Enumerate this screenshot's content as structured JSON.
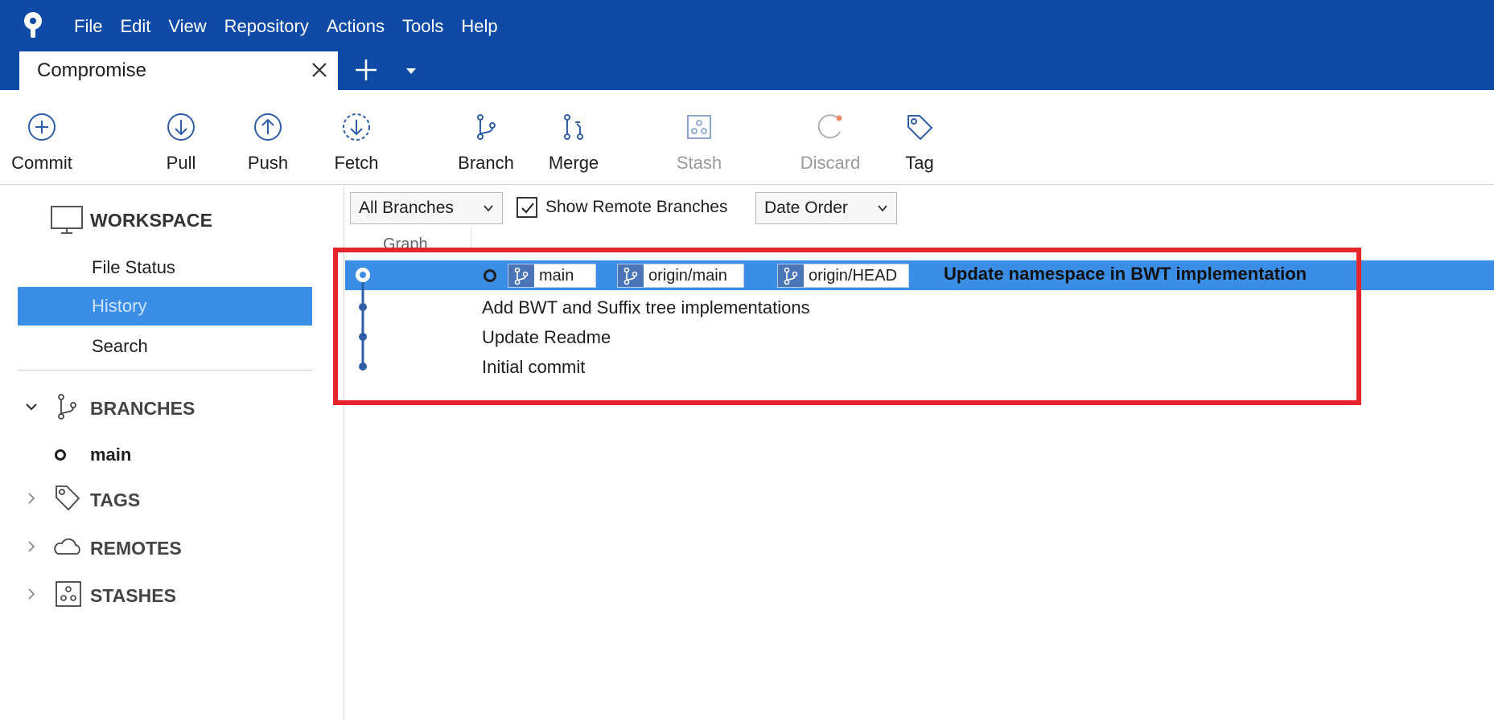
{
  "menu": [
    "File",
    "Edit",
    "View",
    "Repository",
    "Actions",
    "Tools",
    "Help"
  ],
  "tab": {
    "title": "Compromise"
  },
  "toolbar": {
    "commit": "Commit",
    "pull": "Pull",
    "push": "Push",
    "fetch": "Fetch",
    "branch": "Branch",
    "merge": "Merge",
    "stash": "Stash",
    "discard": "Discard",
    "tag": "Tag"
  },
  "sidebar": {
    "workspace_title": "WORKSPACE",
    "items": [
      "File Status",
      "History",
      "Search"
    ],
    "selected_item": "History",
    "sections": {
      "branches": "BRANCHES",
      "tags": "TAGS",
      "remotes": "REMOTES",
      "stashes": "STASHES"
    },
    "current_branch": "main"
  },
  "filter": {
    "branches_select": "All Branches",
    "show_remote_label": "Show Remote Branches",
    "show_remote_checked": true,
    "order_select": "Date Order"
  },
  "columns": {
    "graph": "Graph"
  },
  "commits": [
    {
      "message": "Update namespace in BWT implementation",
      "refs": [
        "main",
        "origin/main",
        "origin/HEAD"
      ],
      "selected": true
    },
    {
      "message": "Add BWT and Suffix tree implementations"
    },
    {
      "message": "Update Readme"
    },
    {
      "message": "Initial commit"
    }
  ],
  "colors": {
    "title_bar": "#0e4aa6",
    "selection": "#3a8ee6",
    "highlight": "#e5242b",
    "graph_line": "#2f5ea8"
  },
  "icons": {
    "app_logo": "sourcetree-logo",
    "commit": "plus-circle-icon",
    "pull": "arrow-down-circle-icon",
    "push": "arrow-up-circle-icon",
    "fetch": "dashed-arrow-down-circle-icon",
    "branch": "branch-icon",
    "merge": "merge-icon",
    "stash": "stash-icon",
    "discard": "undo-icon",
    "tag": "tag-icon"
  }
}
